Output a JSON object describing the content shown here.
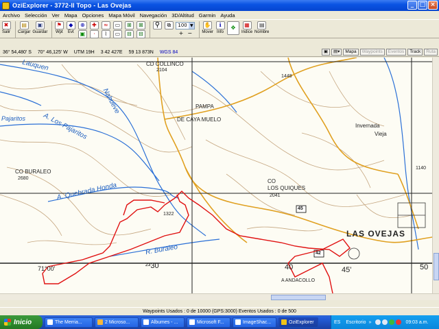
{
  "window": {
    "title": "OziExplorer - 3772-II Topo - Las Ovejas",
    "minimize": "_",
    "maximize": "□",
    "close": "×"
  },
  "menu": [
    "Archivo",
    "Selección",
    "Ver",
    "Mapa",
    "Opciones",
    "Mapa Móvil",
    "Navegación",
    "3D/Altitud",
    "Garmin",
    "Ayuda"
  ],
  "toolbar": {
    "salir": "Salir",
    "cargar": "Cargar",
    "guardar": "Guardar",
    "wpt": "Wpt",
    "evt": "Evt",
    "zoom_value": "100",
    "mover": "Mover",
    "info": "Info",
    "indice": "Indice",
    "nombre": "Nombre"
  },
  "coords": {
    "lat": "36° 54,480' S",
    "lon": "70° 46,125' W",
    "utm": "UTM 19H",
    "east": "3 42 427E",
    "north": "59 13 873N",
    "datum": "WGS 84",
    "tabs": [
      "Mapa",
      "Waypoints",
      "Eventos",
      "Track",
      "Ruta"
    ]
  },
  "map": {
    "labels": {
      "collinco": "CD COLLINCO",
      "collinco_elev": "2104",
      "elev_1448": "1448",
      "pampa": "PAMPA",
      "caya_muelo": "DE CAYA MUELO",
      "invernada": "Invernada",
      "vieja": "Vieja",
      "pajaritos": "A. Los Pajaritos",
      "pajaritos2": "Pajaritos",
      "buraleo": "CO BURALEO",
      "buraleo_elev": "2680",
      "quebrada": "A. Quebrada Honda",
      "quiques": "LOS QUIQUES",
      "co": "CO",
      "quiques_elev": "2041",
      "elev_1322": "1322",
      "las_ovejas": "LAS OVEJAS",
      "r_buraleo": "R. Buraleo",
      "andacollo": "A ANDACOLLO",
      "grid_7100": "71°00'",
      "grid_2330": "²³30",
      "grid_40": "40",
      "grid_45": "45'",
      "grid_50": "50",
      "road_45": "45",
      "road_42": "42",
      "elev_1140": "1140",
      "lauquen": "Lauquen",
      "nahueve": "Nahueve"
    },
    "colors": {
      "contour": "#b38a5a",
      "road": "#e0a020",
      "river": "#2a6fd6",
      "track": "#e01010",
      "grid": "#202020"
    }
  },
  "status": "Waypoints Usados : 0 de 10000  (GPS:3000)  Eventos Usados : 0 de 500",
  "taskbar": {
    "start": "Inicio",
    "tasks": [
      "The Merria...",
      "2 Microso...",
      "Albumes - ...",
      "Microsoft F...",
      "ImageShac...",
      "OziExplorer"
    ],
    "lang": "ES",
    "desktop": "Escritorio",
    "clock": "09:03 a.m."
  }
}
